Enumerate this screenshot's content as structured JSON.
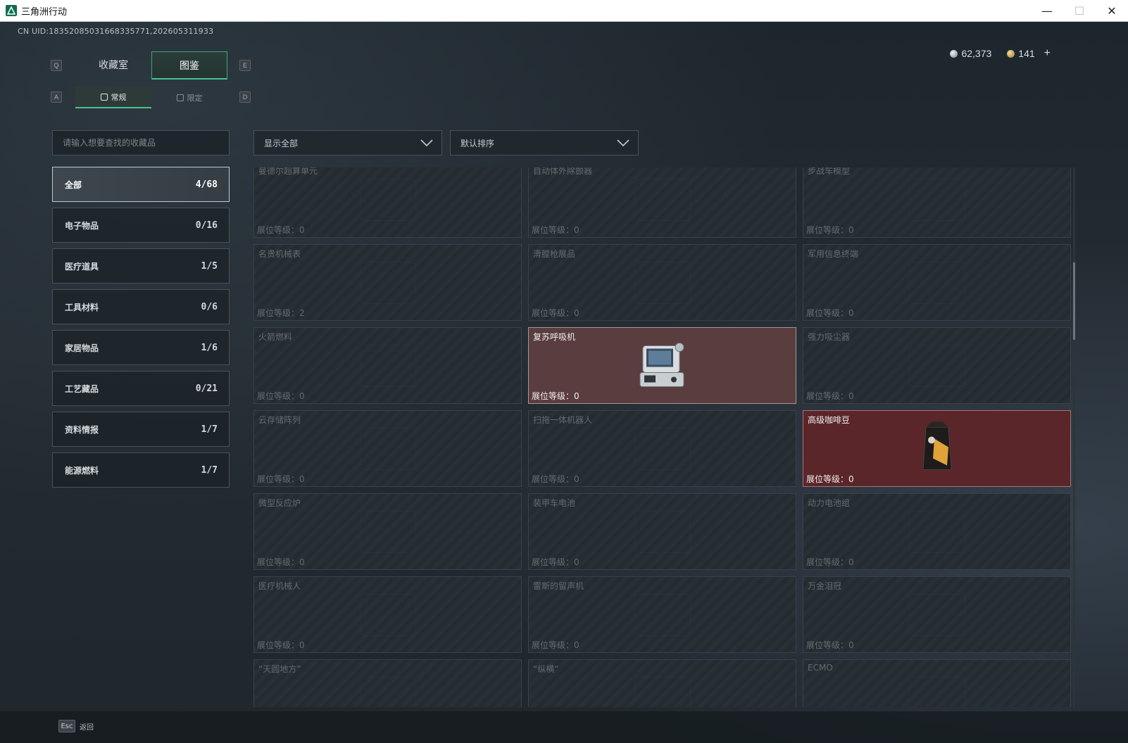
{
  "window": {
    "title": "三角洲行动",
    "minimize": "—",
    "maximize": "☐",
    "close": "✕"
  },
  "uid": "CN UID:18352085031668335771,202605311933",
  "currency": {
    "silver": "62,373",
    "gold": "141",
    "add": "+"
  },
  "keys": {
    "prev_tab": "Q",
    "next_tab": "E",
    "prev_sub": "A",
    "next_sub": "D"
  },
  "tabs": {
    "collection": "收藏室",
    "catalog": "图鉴"
  },
  "subtabs": {
    "regular": "常规",
    "limited": "限定"
  },
  "search": {
    "placeholder": "请输入想要查找的收藏品"
  },
  "categories": [
    {
      "label": "全部",
      "count": "4/68"
    },
    {
      "label": "电子物品",
      "count": "0/16"
    },
    {
      "label": "医疗道具",
      "count": "1/5"
    },
    {
      "label": "工具材料",
      "count": "0/6"
    },
    {
      "label": "家居物品",
      "count": "1/6"
    },
    {
      "label": "工艺藏品",
      "count": "0/21"
    },
    {
      "label": "资料情报",
      "count": "1/7"
    },
    {
      "label": "能源燃料",
      "count": "1/7"
    }
  ],
  "filters": {
    "show": "显示全部",
    "sort": "默认排序"
  },
  "level_label": "展位等级：",
  "items": [
    {
      "name": "曼德尔超算单元",
      "level": "0",
      "owned": false
    },
    {
      "name": "自动体外除颤器",
      "level": "0",
      "owned": false
    },
    {
      "name": "步战车模型",
      "level": "0",
      "owned": false
    },
    {
      "name": "名贵机械表",
      "level": "2",
      "owned": false
    },
    {
      "name": "滑膛枪展品",
      "level": "0",
      "owned": false
    },
    {
      "name": "军用信息终端",
      "level": "0",
      "owned": false
    },
    {
      "name": "火箭燃料",
      "level": "0",
      "owned": false
    },
    {
      "name": "复苏呼吸机",
      "level": "0",
      "owned": true
    },
    {
      "name": "强力吸尘器",
      "level": "0",
      "owned": false
    },
    {
      "name": "云存储阵列",
      "level": "0",
      "owned": false
    },
    {
      "name": "扫拖一体机器人",
      "level": "0",
      "owned": false
    },
    {
      "name": "高级咖啡豆",
      "level": "0",
      "owned": true
    },
    {
      "name": "微型反应炉",
      "level": "0",
      "owned": false
    },
    {
      "name": "装甲车电池",
      "level": "0",
      "owned": false
    },
    {
      "name": "动力电池组",
      "level": "0",
      "owned": false
    },
    {
      "name": "医疗机械人",
      "level": "0",
      "owned": false
    },
    {
      "name": "雷斯的留声机",
      "level": "0",
      "owned": false
    },
    {
      "name": "万金泪冠",
      "level": "0",
      "owned": false
    },
    {
      "name": "“天圆地方”",
      "level": "",
      "owned": false
    },
    {
      "name": "“纵横”",
      "level": "",
      "owned": false
    },
    {
      "name": "ECMO",
      "level": "",
      "owned": false
    }
  ],
  "footer": {
    "esc_key": "Esc",
    "back": "返回"
  }
}
